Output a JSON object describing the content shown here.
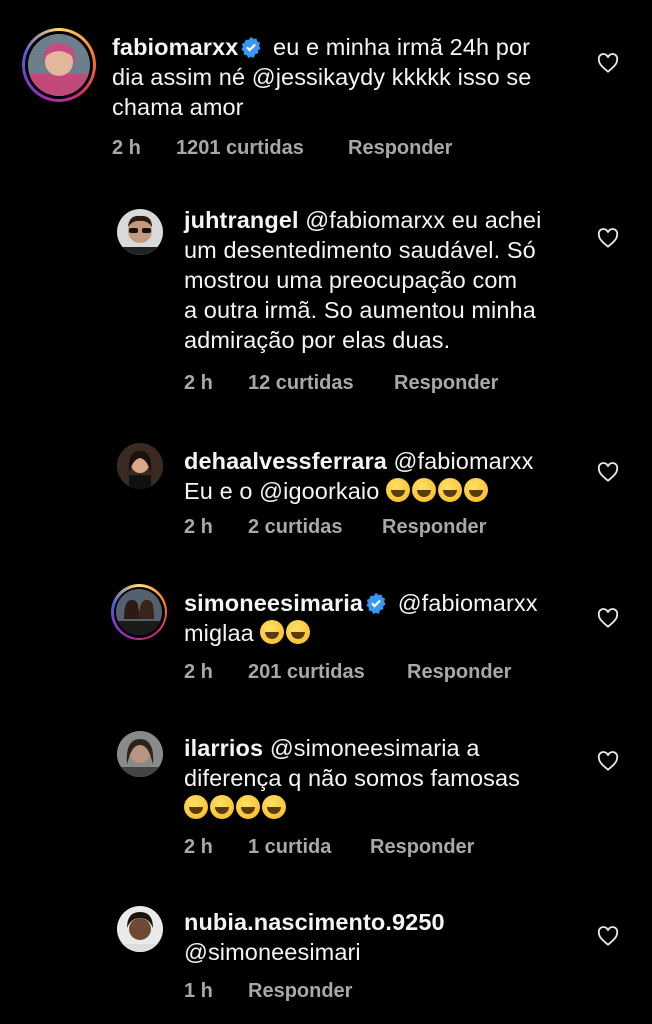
{
  "comments": [
    {
      "username": "fabiomarxx",
      "verified": true,
      "lines": [
        "eu e minha irmã 24h por",
        "dia assim né @jessikaydy kkkkk isso se",
        "chama amor"
      ],
      "time": "2 h",
      "likes": "1201 curtidas",
      "reply": "Responder",
      "avatar_icon": "profile-photo-icon"
    },
    {
      "username": "juhtrangel",
      "verified": false,
      "lines": [
        "@fabiomarxx eu achei",
        "um desentedimento saudável. Só",
        "mostrou uma preocupação com",
        "a outra irmã. So aumentou minha",
        "admiração por elas duas."
      ],
      "time": "2 h",
      "likes": "12 curtidas",
      "reply": "Responder"
    },
    {
      "username": "dehaalvessferrara",
      "verified": false,
      "lines": [
        "@fabiomarxx",
        "Eu e o @igoorkaio"
      ],
      "time": "2 h",
      "likes": "2 curtidas",
      "reply": "Responder"
    },
    {
      "username": "simoneesimaria",
      "verified": true,
      "lines": [
        "@fabiomarxx",
        "miglaa"
      ],
      "time": "2 h",
      "likes": "201 curtidas",
      "reply": "Responder"
    },
    {
      "username": "ilarrios",
      "verified": false,
      "lines": [
        "@simoneesimaria a",
        "diferença q não somos famosas"
      ],
      "time": "2 h",
      "likes": "1 curtida",
      "reply": "Responder"
    },
    {
      "username": "nubia.nascimento.9250",
      "verified": false,
      "lines": [
        "",
        "@simoneesimari"
      ],
      "time": "1 h",
      "likes": "",
      "reply": "Responder"
    }
  ],
  "colors": {
    "background": "#000000",
    "text": "#f5f5f5",
    "meta": "#a8a8a8",
    "verified": "#3897f0"
  },
  "icons": {
    "like": "heart-icon",
    "verified": "verified-badge-icon",
    "emoji_rofl": "rolling-on-floor-laughing-emoji",
    "emoji_grin": "grinning-sweat-emoji"
  }
}
